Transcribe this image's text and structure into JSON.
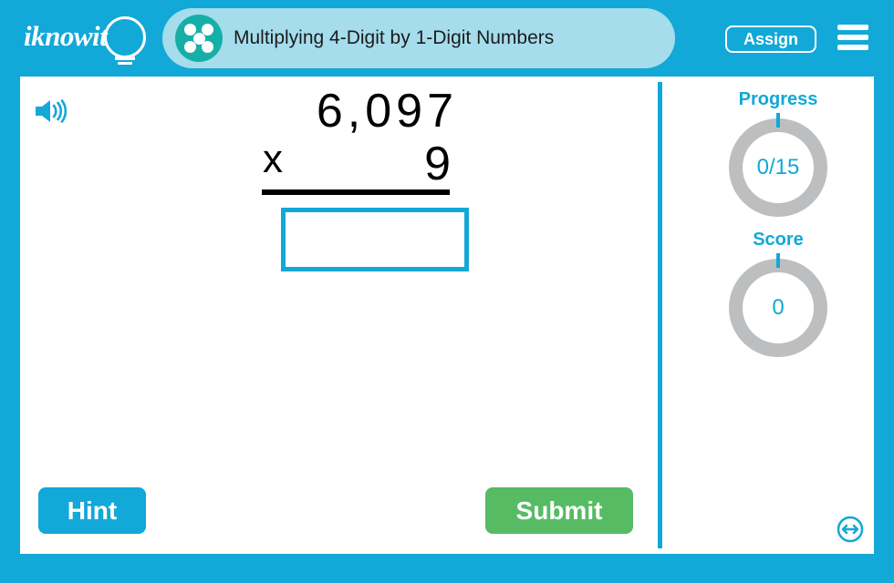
{
  "header": {
    "logo_text": "iknowit",
    "logo_icon": "lightbulb-icon",
    "dots_icon": "five-dots-icon",
    "title": "Multiplying 4-Digit by 1-Digit Numbers",
    "assign_label": "Assign",
    "menu_icon": "hamburger-menu-icon"
  },
  "content": {
    "audio_icon": "speaker-icon",
    "problem": {
      "multiplicand": "6,097",
      "operator": "x",
      "multiplier": "9",
      "answer_value": "",
      "answer_placeholder": ""
    }
  },
  "sidebar": {
    "progress_label": "Progress",
    "progress_value": "0/15",
    "score_label": "Score",
    "score_value": "0"
  },
  "footer": {
    "hint_label": "Hint",
    "submit_label": "Submit",
    "resize_icon": "resize-horizontal-icon"
  },
  "colors": {
    "brand_blue": "#12A8D8",
    "band_light_blue": "#A5DDEC",
    "dots_teal": "#16AFA8",
    "submit_green": "#57BB63",
    "ring_gray": "#BCBEC0",
    "text_dark": "#1c1c1c"
  }
}
